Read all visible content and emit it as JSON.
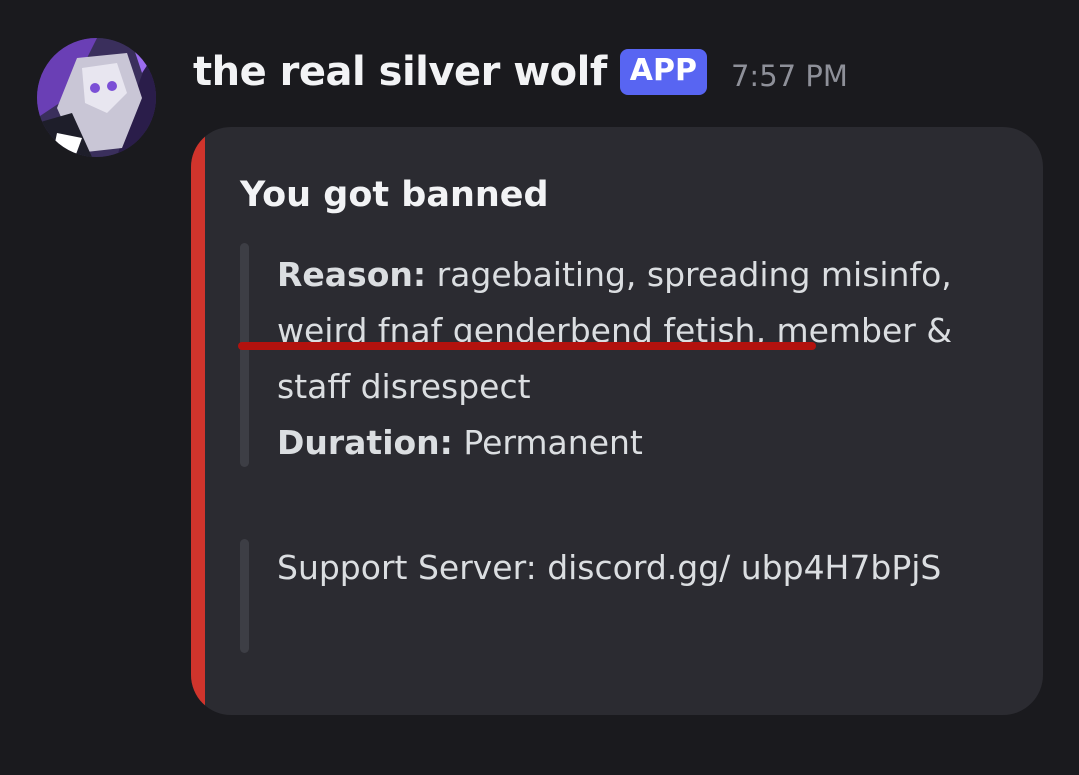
{
  "message": {
    "author": "the real silver wolf",
    "badge": "APP",
    "timestamp": "7:57 PM",
    "avatar_icon": "avatar-icon"
  },
  "embed": {
    "accent_color": "#d0342c",
    "title": "You got banned",
    "reason_label": "Reason:",
    "reason_text": "ragebaiting, spreading misinfo, weird fnaf genderbend fetish, member & staff disrespect",
    "duration_label": "Duration:",
    "duration_text": "Permanent",
    "support_text": "Support Server: discord.gg/ ubp4H7bPjS"
  },
  "annotation": {
    "color": "#b3120e"
  }
}
